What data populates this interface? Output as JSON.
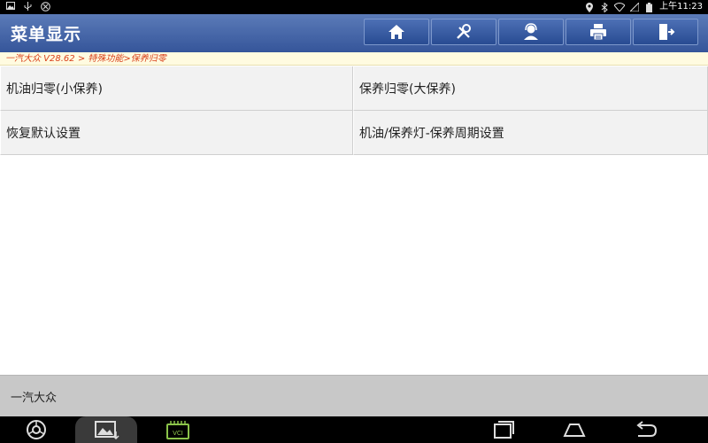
{
  "status_bar": {
    "left_icons": [
      "image-icon",
      "usb-icon",
      "usb-debug-icon"
    ],
    "right_icons": [
      "location-icon",
      "bluetooth-icon",
      "wifi-icon",
      "signal-icon",
      "battery-icon"
    ],
    "time": "上午11:23"
  },
  "header": {
    "title": "菜单显示",
    "toolbar_icons": [
      "home-icon",
      "diagnostic-tools-icon",
      "support-agent-icon",
      "printer-icon",
      "exit-icon"
    ]
  },
  "breadcrumb": "一汽大众 V28.62 > 特殊功能>保养归零",
  "menu": {
    "items": [
      {
        "label": "机油归零(小保养)"
      },
      {
        "label": "保养归零(大保养)"
      },
      {
        "label": "恢复默认设置"
      },
      {
        "label": "机油/保养灯-保养周期设置"
      }
    ]
  },
  "footer": {
    "vehicle": "一汽大众"
  },
  "nav_bar": {
    "buttons": [
      "browser-icon",
      "gallery-icon",
      "vci-icon",
      "recent-apps-icon",
      "home-nav-icon",
      "back-icon"
    ],
    "vci_label": "VCI"
  },
  "colors": {
    "title_bar": "#35559a",
    "breadcrumb_text": "#d9401a",
    "breadcrumb_bg": "#fffbe0",
    "menu_bg": "#f2f2f2",
    "footer_bg": "#c8c8c8",
    "vci_green": "#8bc34a"
  }
}
